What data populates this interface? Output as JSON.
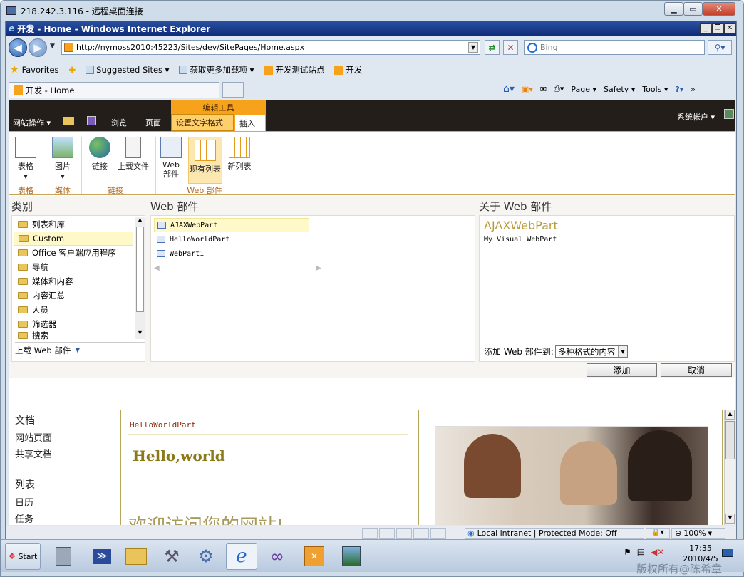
{
  "rdp": {
    "title": "218.242.3.116 - 远程桌面连接"
  },
  "ie": {
    "title": "开发 - Home - Windows Internet Explorer",
    "address": "http://nymoss2010:45223/Sites/dev/SitePages/Home.aspx",
    "search_placeholder": "Bing",
    "favorites_label": "Favorites",
    "fav_items": [
      "Suggested Sites ▾",
      "获取更多加载项 ▾",
      "开发测试站点",
      "开发"
    ],
    "tab_label": "开发 - Home",
    "commands": [
      "Page ▾",
      "Safety ▾",
      "Tools ▾"
    ]
  },
  "ribbon": {
    "site_actions": "网站操作 ▾",
    "browse": "浏览",
    "page": "页面",
    "context_group": "编辑工具",
    "tab_format": "设置文字格式",
    "tab_insert": "插入",
    "user": "系统帐户 ▾",
    "buttons": [
      "表格",
      "图片",
      "链接",
      "上载文件",
      "Web 部件",
      "现有列表",
      "新列表"
    ],
    "groups": [
      "表格",
      "媒体",
      "链接",
      "Web 部件"
    ]
  },
  "gallery": {
    "categories_header": "类别",
    "webparts_header": "Web 部件",
    "about_header": "关于 Web 部件",
    "categories": [
      "列表和库",
      "Custom",
      "Office 客户端应用程序",
      "导航",
      "媒体和内容",
      "内容汇总",
      "人员",
      "筛选器",
      "搜索"
    ],
    "upload": "上载 Web 部件",
    "webparts": [
      "AJAXWebPart",
      "HelloWorldPart",
      "WebPart1"
    ],
    "about_title": "AJAXWebPart",
    "about_desc": "My Visual WebPart",
    "add_to_label": "添加 Web 部件到:",
    "add_to_value": "多种格式的内容",
    "add_button": "添加",
    "cancel_button": "取消"
  },
  "leftnav": {
    "libraries": "文档",
    "items_a": [
      "网站页面",
      "共享文档"
    ],
    "lists": "列表",
    "items_b": [
      "日历",
      "任务"
    ]
  },
  "content": {
    "webpart_title": "HelloWorldPart",
    "hello": "Hello,world",
    "welcome": "欢迎访问您的网站!"
  },
  "status": {
    "zone": "Local intranet | Protected Mode: Off",
    "zoom": "100%"
  },
  "taskbar": {
    "start": "Start",
    "time": "17:35",
    "date": "2010/4/5",
    "watermark": "版权所有@陈希章"
  }
}
